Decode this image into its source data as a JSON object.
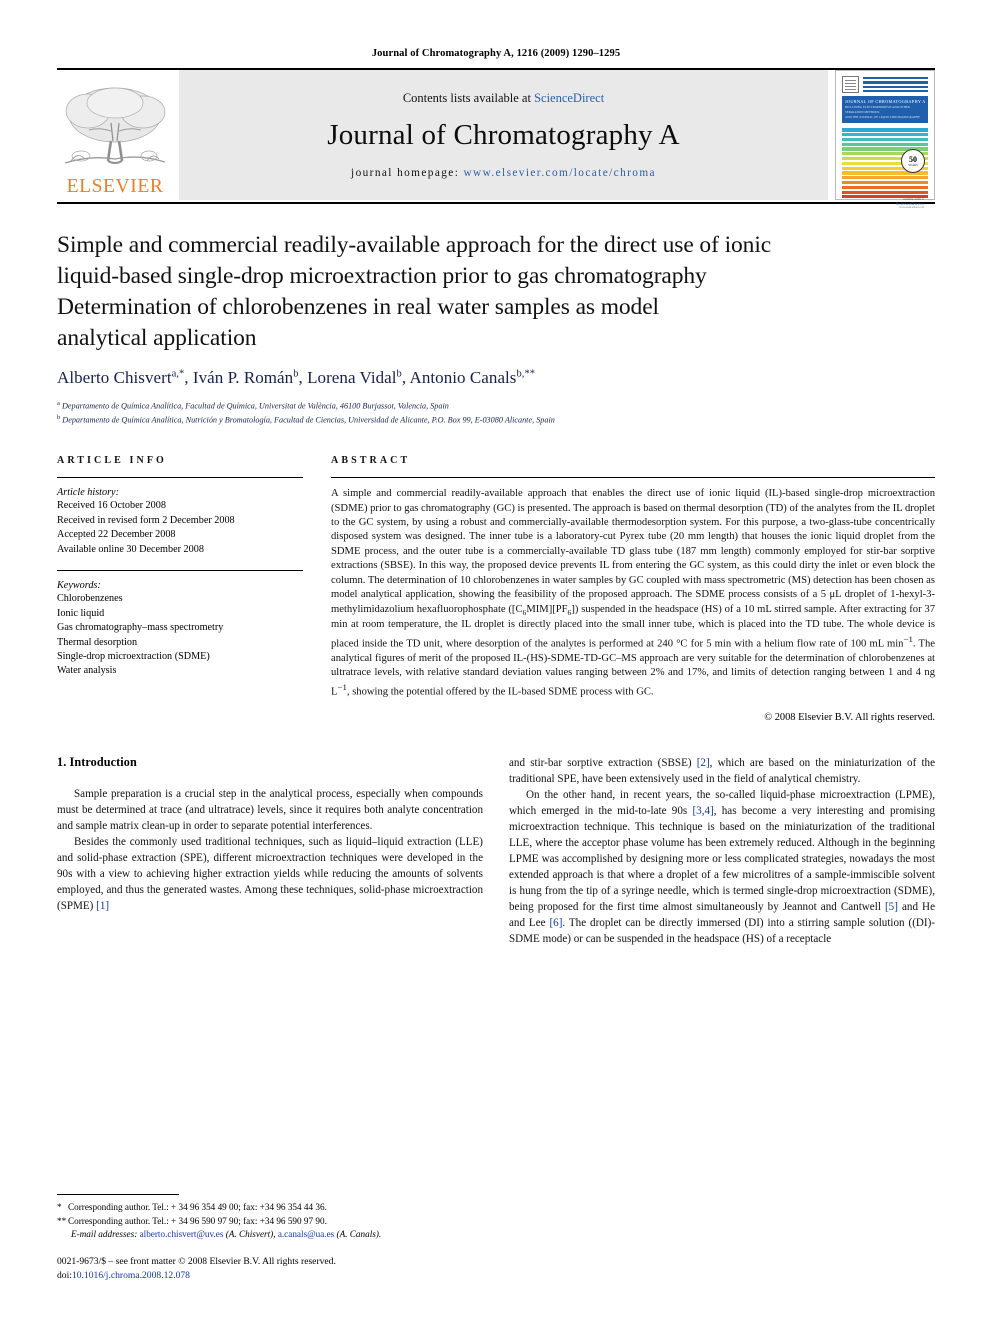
{
  "running_head": "Journal of Chromatography A, 1216 (2009) 1290–1295",
  "masthead": {
    "publisher_name": "ELSEVIER",
    "contents_prefix": "Contents lists available at ",
    "contents_link": "ScienceDirect",
    "journal_name": "Journal of Chromatography A",
    "homepage_prefix": "journal homepage: ",
    "homepage_url": "www.elsevier.com/locate/chroma",
    "cover": {
      "banner_title": "JOURNAL OF CHROMATOGRAPHY A",
      "banner_sub_1": "INCLUDING ELECTROPHORESIS AND OTHER SEPARATION METHODS",
      "banner_sub_2": "AND THE JOURNAL OF LIQUID CHROMATOGRAPHY",
      "seal_number": "50",
      "seal_label": "YEARS",
      "foot_1": "Available online at",
      "foot_2": "ScienceDirect",
      "foot_3": "www.sciencedirect.com",
      "bar_colors": [
        "#2aa9d6",
        "#34b5c9",
        "#3fc0b4",
        "#57c79a",
        "#7bcf7a",
        "#a8d65f",
        "#cfdc4a",
        "#eddc3c",
        "#f5cf30",
        "#f7be2c",
        "#f4a72a",
        "#ef8b27",
        "#e86f24",
        "#e05423",
        "#d63f25"
      ]
    }
  },
  "article": {
    "title_lines": [
      "Simple and commercial readily-available approach for the direct use of ionic",
      "liquid-based single-drop microextraction prior to gas chromatography",
      "Determination of chlorobenzenes in real water samples as model",
      "analytical application"
    ],
    "authors": [
      {
        "name": "Alberto Chisvert",
        "sup": "a,*"
      },
      {
        "name": "Iván P. Román",
        "sup": "b"
      },
      {
        "name": "Lorena Vidal",
        "sup": "b"
      },
      {
        "name": "Antonio Canals",
        "sup": "b,**"
      }
    ],
    "affiliations": [
      {
        "mark": "a",
        "text": "Departamento de Química Analítica, Facultad de Química, Universitat de València, 46100 Burjassot, Valencia, Spain"
      },
      {
        "mark": "b",
        "text": "Departamento de Química Analítica, Nutrición y Bromatología, Facultad de Ciencias, Universidad de Alicante, P.O. Box 99, E-03080 Alicante, Spain"
      }
    ]
  },
  "article_info": {
    "label": "ARTICLE INFO",
    "history_title": "Article history:",
    "history": [
      "Received 16 October 2008",
      "Received in revised form 2 December 2008",
      "Accepted 22 December 2008",
      "Available online 30 December 2008"
    ],
    "keywords_title": "Keywords:",
    "keywords": [
      "Chlorobenzenes",
      "Ionic liquid",
      "Gas chromatography–mass spectrometry",
      "Thermal desorption",
      "Single-drop microextraction (SDME)",
      "Water analysis"
    ]
  },
  "abstract": {
    "label": "ABSTRACT",
    "part1": "A simple and commercial readily-available approach that enables the direct use of ionic liquid (IL)-based single-drop microextraction (SDME) prior to gas chromatography (GC) is presented. The approach is based on thermal desorption (TD) of the analytes from the IL droplet to the GC system, by using a robust and commercially-available thermodesorption system. For this purpose, a two-glass-tube concentrically disposed system was designed. The inner tube is a laboratory-cut Pyrex tube (20 mm length) that houses the ionic liquid droplet from the SDME process, and the outer tube is a commercially-available TD glass tube (187 mm length) commonly employed for stir-bar sorptive extractions (SBSE). In this way, the proposed device prevents IL from entering the GC system, as this could dirty the inlet or even block the column. The determination of 10 chlorobenzenes in water samples by GC coupled with mass spectrometric (MS) detection has been chosen as model analytical application, showing the feasibility of the proposed approach. The SDME process consists of a 5 μL droplet of 1-hexyl-3-methylimidazolium hexafluorophosphate ([C",
    "sub1": "6",
    "part2": "MIM][PF",
    "sub2": "6",
    "part3": "]) suspended in the headspace (HS) of a 10 mL stirred sample. After extracting for 37 min at room temperature, the IL droplet is directly placed into the small inner tube, which is placed into the TD tube. The whole device is placed inside the TD unit, where desorption of the analytes is performed at 240 °C for 5 min with a helium flow rate of 100 mL min",
    "sup1": "−1",
    "part4": ". The analytical figures of merit of the proposed IL-(HS)-SDME-TD-GC–MS approach are very suitable for the determination of chlorobenzenes at ultratrace levels, with relative standard deviation values ranging between 2% and 17%, and limits of detection ranging between 1 and 4 ng L",
    "sup2": "−1",
    "part5": ", showing the potential offered by the IL-based SDME process with GC.",
    "copyright": "© 2008 Elsevier B.V. All rights reserved."
  },
  "body": {
    "section_number_title": "1. Introduction",
    "left_paragraphs": [
      "Sample preparation is a crucial step in the analytical process, especially when compounds must be determined at trace (and ultratrace) levels, since it requires both analyte concentration and sample matrix clean-up in order to separate potential interferences.",
      "Besides the commonly used traditional techniques, such as liquid–liquid extraction (LLE) and solid-phase extraction (SPE), different microextraction techniques were developed in the 90s with a view to achieving higher extraction yields while reducing the amounts of solvents employed, and thus the generated wastes. Among these techniques, solid-phase microextraction (SPME) "
    ],
    "left_tail_ref": "[1]",
    "right_paragraph_1_pre": "and stir-bar sorptive extraction (SBSE) ",
    "right_paragraph_1_ref": "[2]",
    "right_paragraph_1_post": ", which are based on the miniaturization of the traditional SPE, have been extensively used in the field of analytical chemistry.",
    "right_paragraph_2_pre": "On the other hand, in recent years, the so-called liquid-phase microextraction (LPME), which emerged in the mid-to-late 90s ",
    "right_paragraph_2_ref": "[3,4]",
    "right_paragraph_2_post": ", has become a very interesting and promising microextraction technique. This technique is based on the miniaturization of the traditional LLE, where the acceptor phase volume has been extremely reduced. Although in the beginning LPME was accomplished by designing more or less complicated strategies, nowadays the most extended approach is that where a droplet of a few microlitres of a sample-immiscible solvent is hung from the tip of a syringe needle, which is termed single-drop microextraction (SDME), being proposed for the first time almost simultaneously by Jeannot and Cantwell ",
    "right_paragraph_2_ref2": "[5]",
    "right_paragraph_2_mid": " and He and Lee ",
    "right_paragraph_2_ref3": "[6]",
    "right_paragraph_2_end": ". The droplet can be directly immersed (DI) into a stirring sample solution ((DI)-SDME mode) or can be suspended in the headspace (HS) of a receptacle"
  },
  "footnotes": {
    "line1_mark": "*",
    "line1": "Corresponding author. Tel.: + 34 96 354 49 00; fax: +34 96 354 44 36.",
    "line2_mark": "**",
    "line2": "Corresponding author. Tel.: + 34 96 590 97 90; fax: +34 96 590 97 90.",
    "email_label": "E-mail addresses:",
    "email1": "alberto.chisvert@uv.es",
    "email1_name": " (A. Chisvert),",
    "email2": "a.canals@ua.es",
    "email2_name": " (A. Canals).",
    "issn_line": "0021-9673/$ – see front matter © 2008 Elsevier B.V. All rights reserved.",
    "doi_label": "doi:",
    "doi_value": "10.1016/j.chroma.2008.12.078"
  }
}
